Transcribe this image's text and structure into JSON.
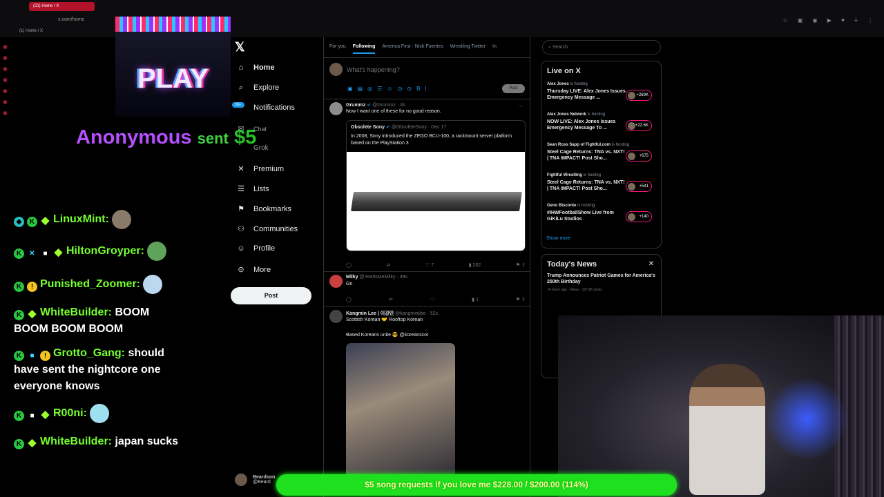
{
  "browser": {
    "tab_title": "(21) Home / X",
    "url": "x.com/home",
    "breadcrumb": "(1) Home / X"
  },
  "overlay": {
    "play_label": "PLAY",
    "alert_name": "Anonymous",
    "alert_verb": "sent",
    "alert_amount": "$5"
  },
  "chat": [
    {
      "user": "LinuxMint:",
      "message": ""
    },
    {
      "user": "HiltonGroyper:",
      "message": ""
    },
    {
      "user": "Punished_Zoomer:",
      "message": ""
    },
    {
      "user": "WhiteBuilder:",
      "message": "BOOM BOOM BOOM BOOM"
    },
    {
      "user": "Grotto_Gang:",
      "message": "should have sent the nightcore one everyone knows"
    },
    {
      "user": "R00ni:",
      "message": ""
    },
    {
      "user": "WhiteBuilder:",
      "message": "japan sucks"
    }
  ],
  "nav": {
    "items": [
      "Home",
      "Explore",
      "Notifications",
      "Chat",
      "Grok",
      "Premium",
      "Lists",
      "Bookmarks",
      "Communities",
      "Profile",
      "More"
    ],
    "post_label": "Post",
    "notif_badge": "20+",
    "profile_name": "Beardson",
    "profile_handle": "@Beard"
  },
  "timeline": {
    "tabs": [
      "For you",
      "Following",
      "America First - Nick Fuentes",
      "Wrestling Twitter",
      "In"
    ],
    "active_tab": "Following",
    "compose_placeholder": "What's happening?",
    "compose_post": "Post",
    "tweets": [
      {
        "name": "Grummz",
        "handle": "@Grummz · 4s",
        "text": "Now I want one of these for no good reason.",
        "quote_name": "Obsolete Sony",
        "quote_handle": "@ObsoleteSony · Dec 17",
        "quote_text": "In 2008, Sony introduced the ZEGO BCU-100, a rackmount server platform based on the PlayStation 3",
        "likes": "7",
        "views": "202"
      },
      {
        "name": "Milky",
        "handle": "@YeaItsMeMilky · 49s",
        "text": "Gn",
        "views": "1"
      },
      {
        "name": "Kangmin Lee | 이강민",
        "handle": "@kangminjlee · 52s",
        "text": "Scottish Korean 🤝 Rooftop Korean",
        "text2": "Based Koreans unite 😎 @koreanscot"
      }
    ]
  },
  "right": {
    "search_placeholder": "Search",
    "live_title": "Live on X",
    "live": [
      {
        "host": "Alex Jones",
        "status": "is hosting",
        "title": "Thursday LIVE: Alex Jones Issues Emergency Message ...",
        "count": "+269K"
      },
      {
        "host": "Alex Jones Network",
        "status": "is hosting",
        "title": "NOW LIVE: Alex Jones Issues Emergency Message To ...",
        "count": "+22.6K"
      },
      {
        "host": "Sean Ross Sapp of Fightful.com",
        "status": "is hosting",
        "title": "Steel Cage Returns: TNA vs. NXT! | TNA IMPACT! Post Sho...",
        "count": "+675"
      },
      {
        "host": "Fightful Wrestling",
        "status": "is hosting",
        "title": "Steel Cage Returns: TNA vs. NXT! | TNA IMPACT! Post Sho...",
        "count": "+541"
      },
      {
        "host": "Geno Bisconte",
        "status": "is hosting",
        "title": "#IHWFootballShow Live from GiKiLu Studios",
        "count": "+140"
      }
    ],
    "show_more": "Show more",
    "news_title": "Today's News",
    "news": [
      {
        "headline": "Trump Announces Patriot Games for America's 250th Birthday",
        "meta": "14 hours ago · News · 127.8K posts"
      }
    ]
  },
  "goal": {
    "text": "$5 song requests if you love me $228.00 / $200.00 (114%)",
    "progress": 1.0
  }
}
